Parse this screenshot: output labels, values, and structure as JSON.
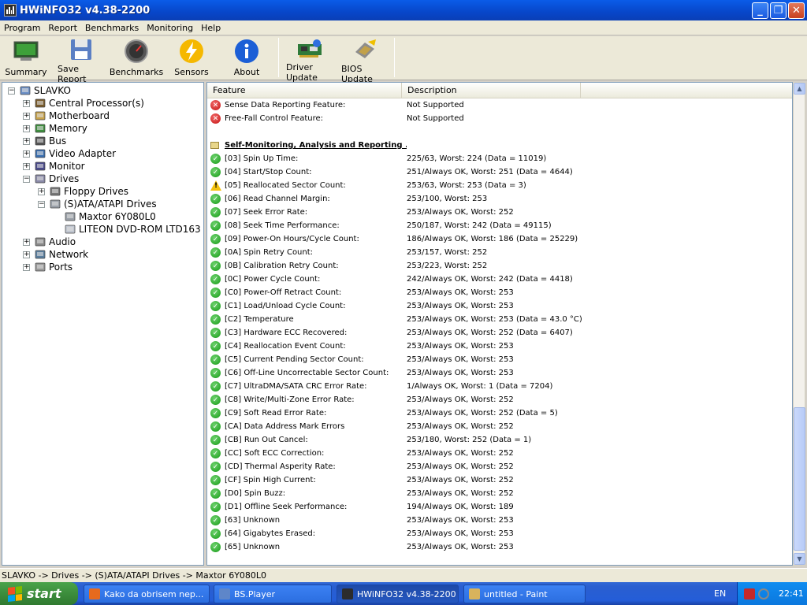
{
  "window": {
    "title": "HWiNFO32 v4.38-2200"
  },
  "menu": [
    "Program",
    "Report",
    "Benchmarks",
    "Monitoring",
    "Help"
  ],
  "toolbar": [
    {
      "label": "Summary",
      "icon": "summary-icon"
    },
    {
      "label": "Save Report",
      "icon": "floppy-icon"
    },
    {
      "label": "Benchmarks",
      "icon": "gauge-icon"
    },
    {
      "label": "Sensors",
      "icon": "lightning-icon"
    },
    {
      "label": "About",
      "icon": "info-icon"
    },
    {
      "label": "Driver Update",
      "icon": "driver-card-icon"
    },
    {
      "label": "BIOS Update",
      "icon": "bios-chip-icon"
    }
  ],
  "tree": [
    {
      "label": "SLAVKO",
      "icon": "computer-icon",
      "expander": "−"
    },
    {
      "label": "Central Processor(s)",
      "icon": "cpu-icon",
      "expander": "+"
    },
    {
      "label": "Motherboard",
      "icon": "motherboard-icon",
      "expander": "+"
    },
    {
      "label": "Memory",
      "icon": "memory-icon",
      "expander": "+"
    },
    {
      "label": "Bus",
      "icon": "bus-icon",
      "expander": "+"
    },
    {
      "label": "Video Adapter",
      "icon": "video-adapter-icon",
      "expander": "+"
    },
    {
      "label": "Monitor",
      "icon": "monitor-icon",
      "expander": "+"
    },
    {
      "label": "Drives",
      "icon": "drives-icon",
      "expander": "−"
    },
    {
      "label": "Floppy Drives",
      "icon": "floppy-drive-icon",
      "expander": "+"
    },
    {
      "label": "(S)ATA/ATAPI Drives",
      "icon": "hdd-icon",
      "expander": "−"
    },
    {
      "label": "Maxtor 6Y080L0",
      "icon": "hdd-icon",
      "expander": ""
    },
    {
      "label": "LITEON DVD-ROM LTD163",
      "icon": "cdrom-icon",
      "expander": ""
    },
    {
      "label": "Audio",
      "icon": "audio-icon",
      "expander": "+"
    },
    {
      "label": "Network",
      "icon": "network-icon",
      "expander": "+"
    },
    {
      "label": "Ports",
      "icon": "ports-icon",
      "expander": "+"
    }
  ],
  "list": {
    "columns": [
      "Feature",
      "Description"
    ],
    "rows": [
      {
        "status": "bad",
        "feature": "Sense Data Reporting Feature:",
        "desc": "Not Supported"
      },
      {
        "status": "bad",
        "feature": "Free-Fall Control Feature:",
        "desc": "Not Supported"
      },
      {
        "status": "none",
        "feature": "",
        "desc": ""
      },
      {
        "status": "section",
        "feature": "Self-Monitoring, Analysis and Reporting ...",
        "desc": ""
      },
      {
        "status": "ok",
        "feature": "[03] Spin Up Time:",
        "desc": "225/63, Worst: 224 (Data = 11019)"
      },
      {
        "status": "ok",
        "feature": "[04] Start/Stop Count:",
        "desc": "251/Always OK, Worst: 251 (Data = 4644)"
      },
      {
        "status": "warn",
        "feature": "[05] Reallocated Sector Count:",
        "desc": "253/63, Worst: 253 (Data = 3)"
      },
      {
        "status": "ok",
        "feature": "[06] Read Channel Margin:",
        "desc": "253/100, Worst: 253"
      },
      {
        "status": "ok",
        "feature": "[07] Seek Error Rate:",
        "desc": "253/Always OK, Worst: 252"
      },
      {
        "status": "ok",
        "feature": "[08] Seek Time Performance:",
        "desc": "250/187, Worst: 242 (Data = 49115)"
      },
      {
        "status": "ok",
        "feature": "[09] Power-On Hours/Cycle Count:",
        "desc": "186/Always OK, Worst: 186 (Data = 25229)"
      },
      {
        "status": "ok",
        "feature": "[0A] Spin Retry Count:",
        "desc": "253/157, Worst: 252"
      },
      {
        "status": "ok",
        "feature": "[0B] Calibration Retry Count:",
        "desc": "253/223, Worst: 252"
      },
      {
        "status": "ok",
        "feature": "[0C] Power Cycle Count:",
        "desc": "242/Always OK, Worst: 242 (Data = 4418)"
      },
      {
        "status": "ok",
        "feature": "[C0] Power-Off Retract Count:",
        "desc": "253/Always OK, Worst: 253"
      },
      {
        "status": "ok",
        "feature": "[C1] Load/Unload Cycle Count:",
        "desc": "253/Always OK, Worst: 253"
      },
      {
        "status": "ok",
        "feature": "[C2] Temperature",
        "desc": "253/Always OK, Worst: 253 (Data = 43.0 °C)"
      },
      {
        "status": "ok",
        "feature": "[C3] Hardware ECC Recovered:",
        "desc": "253/Always OK, Worst: 252 (Data = 6407)"
      },
      {
        "status": "ok",
        "feature": "[C4] Reallocation Event Count:",
        "desc": "253/Always OK, Worst: 253"
      },
      {
        "status": "ok",
        "feature": "[C5] Current Pending Sector Count:",
        "desc": "253/Always OK, Worst: 253"
      },
      {
        "status": "ok",
        "feature": "[C6] Off-Line Uncorrectable Sector Count:",
        "desc": "253/Always OK, Worst: 253"
      },
      {
        "status": "ok",
        "feature": "[C7] UltraDMA/SATA CRC Error Rate:",
        "desc": "1/Always OK, Worst: 1 (Data = 7204)"
      },
      {
        "status": "ok",
        "feature": "[C8] Write/Multi-Zone Error Rate:",
        "desc": "253/Always OK, Worst: 252"
      },
      {
        "status": "ok",
        "feature": "[C9] Soft Read Error Rate:",
        "desc": "253/Always OK, Worst: 252 (Data = 5)"
      },
      {
        "status": "ok",
        "feature": "[CA] Data Address Mark Errors",
        "desc": "253/Always OK, Worst: 252"
      },
      {
        "status": "ok",
        "feature": "[CB] Run Out Cancel:",
        "desc": "253/180, Worst: 252 (Data = 1)"
      },
      {
        "status": "ok",
        "feature": "[CC] Soft ECC Correction:",
        "desc": "253/Always OK, Worst: 252"
      },
      {
        "status": "ok",
        "feature": "[CD] Thermal Asperity Rate:",
        "desc": "253/Always OK, Worst: 252"
      },
      {
        "status": "ok",
        "feature": "[CF] Spin High Current:",
        "desc": "253/Always OK, Worst: 252"
      },
      {
        "status": "ok",
        "feature": "[D0] Spin Buzz:",
        "desc": "253/Always OK, Worst: 252"
      },
      {
        "status": "ok",
        "feature": "[D1] Offline Seek Performance:",
        "desc": "194/Always OK, Worst: 189"
      },
      {
        "status": "ok",
        "feature": "[63] Unknown",
        "desc": "253/Always OK, Worst: 253"
      },
      {
        "status": "ok",
        "feature": "[64] Gigabytes Erased:",
        "desc": "253/Always OK, Worst: 253"
      },
      {
        "status": "ok",
        "feature": "[65] Unknown",
        "desc": "253/Always OK, Worst: 253"
      }
    ]
  },
  "statusbar": {
    "path": "SLAVKO -> Drives -> (S)ATA/ATAPI Drives -> Maxtor 6Y080L0"
  },
  "taskbar": {
    "start": "start",
    "tasks": [
      {
        "label": "Kako da obrisem nep...",
        "icon": "firefox-icon",
        "color": "#e66a1e",
        "active": false
      },
      {
        "label": "BS.Player",
        "icon": "bsplayer-icon",
        "color": "#5e86c9",
        "active": false
      },
      {
        "label": "HWiNFO32 v4.38-2200",
        "icon": "hwinfo-icon",
        "color": "#2c2c2c",
        "active": true
      },
      {
        "label": "untitled - Paint",
        "icon": "paint-icon",
        "color": "#d8b35c",
        "active": false
      }
    ],
    "lang": "EN",
    "clock": "22:41"
  }
}
